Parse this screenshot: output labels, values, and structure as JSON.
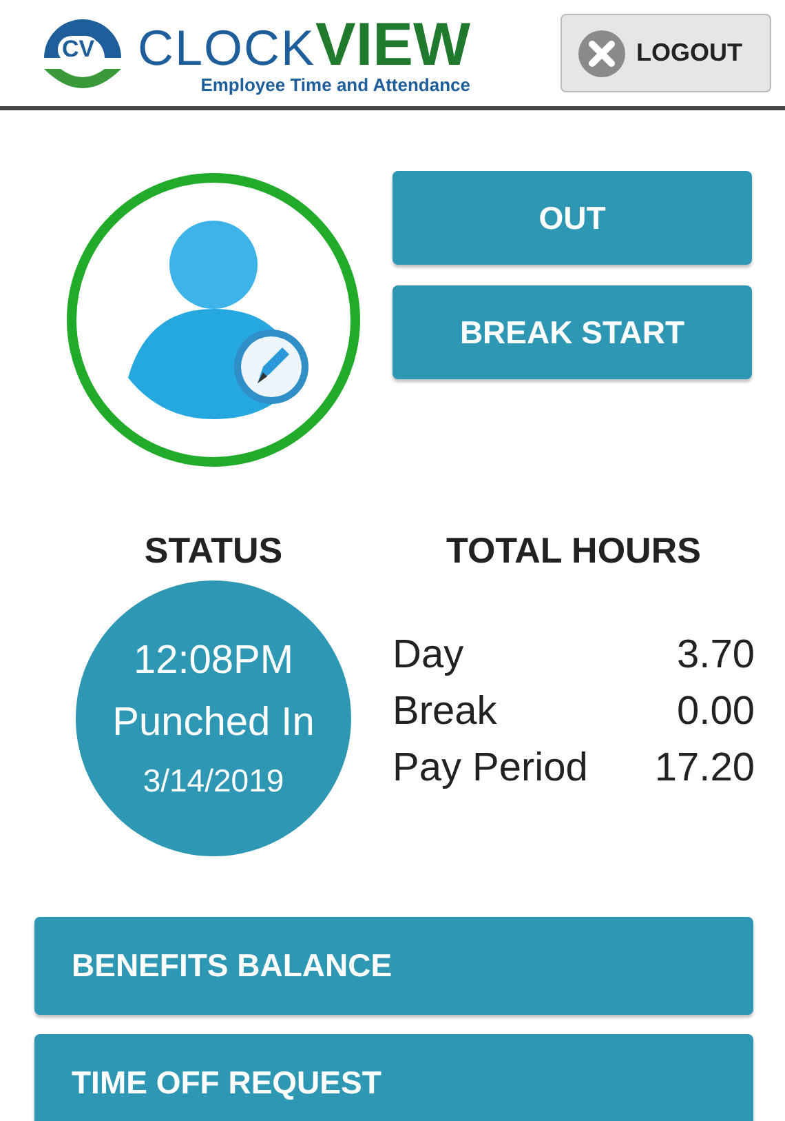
{
  "header": {
    "logo_badge": "CV",
    "logo_word_1": "CLOCK",
    "logo_word_2": "VIEW",
    "tagline": "Employee Time and Attendance",
    "logout": "LOGOUT"
  },
  "punch_buttons": [
    "OUT",
    "BREAK START"
  ],
  "status": {
    "title": "STATUS",
    "time": "12:08PM",
    "state": "Punched In",
    "date": "3/14/2019"
  },
  "total_hours": {
    "title": "TOTAL HOURS",
    "rows": [
      {
        "label": "Day",
        "value": "3.70"
      },
      {
        "label": "Break",
        "value": "0.00"
      },
      {
        "label": "Pay Period",
        "value": "17.20"
      }
    ]
  },
  "menu_buttons": [
    "BENEFITS BALANCE",
    "TIME OFF REQUEST"
  ]
}
